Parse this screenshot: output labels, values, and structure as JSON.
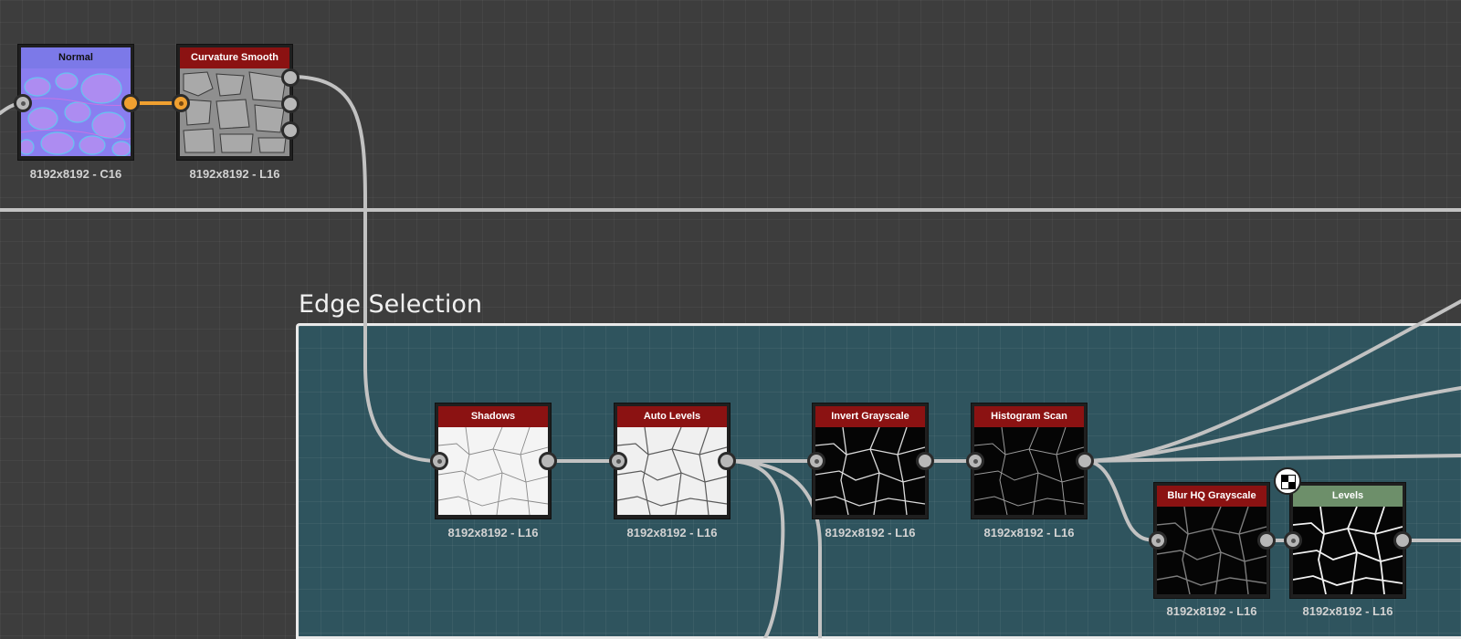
{
  "frame": {
    "title": "Edge Selection"
  },
  "nodes": [
    {
      "id": "normal",
      "title": "Normal",
      "subtitle": "8192x8192 - C16",
      "header_color": "#7c79e8",
      "thumb": "normal"
    },
    {
      "id": "curvature_smooth",
      "title": "Curvature Smooth",
      "subtitle": "8192x8192 - L16",
      "header_color": "#8b1212",
      "thumb": "gray"
    },
    {
      "id": "shadows",
      "title": "Shadows",
      "subtitle": "8192x8192 - L16",
      "header_color": "#8b1212",
      "thumb": "light"
    },
    {
      "id": "auto_levels",
      "title": "Auto Levels",
      "subtitle": "8192x8192 - L16",
      "header_color": "#8b1212",
      "thumb": "light"
    },
    {
      "id": "invert_grayscale",
      "title": "Invert Grayscale",
      "subtitle": "8192x8192 - L16",
      "header_color": "#8b1212",
      "thumb": "dark"
    },
    {
      "id": "histogram_scan",
      "title": "Histogram Scan",
      "subtitle": "8192x8192 - L16",
      "header_color": "#8b1212",
      "thumb": "dark"
    },
    {
      "id": "blur_hq_grayscale",
      "title": "Blur HQ Grayscale",
      "subtitle": "8192x8192 - L16",
      "header_color": "#8b1212",
      "thumb": "dark"
    },
    {
      "id": "levels",
      "title": "Levels",
      "subtitle": "8192x8192 - L16",
      "header_color": "#6d8f6a",
      "thumb": "dark"
    }
  ],
  "colors": {
    "canvas_bg": "#3d3d3d",
    "frame_bg": "#2f545e",
    "wire": "#c2c2c2",
    "wire_selected": "#f0a030",
    "node_header_red": "#8b1212",
    "node_header_green": "#6d8f6a",
    "node_header_normal": "#7c79e8"
  },
  "icons": {
    "output_preview": "checkerboard-icon"
  }
}
